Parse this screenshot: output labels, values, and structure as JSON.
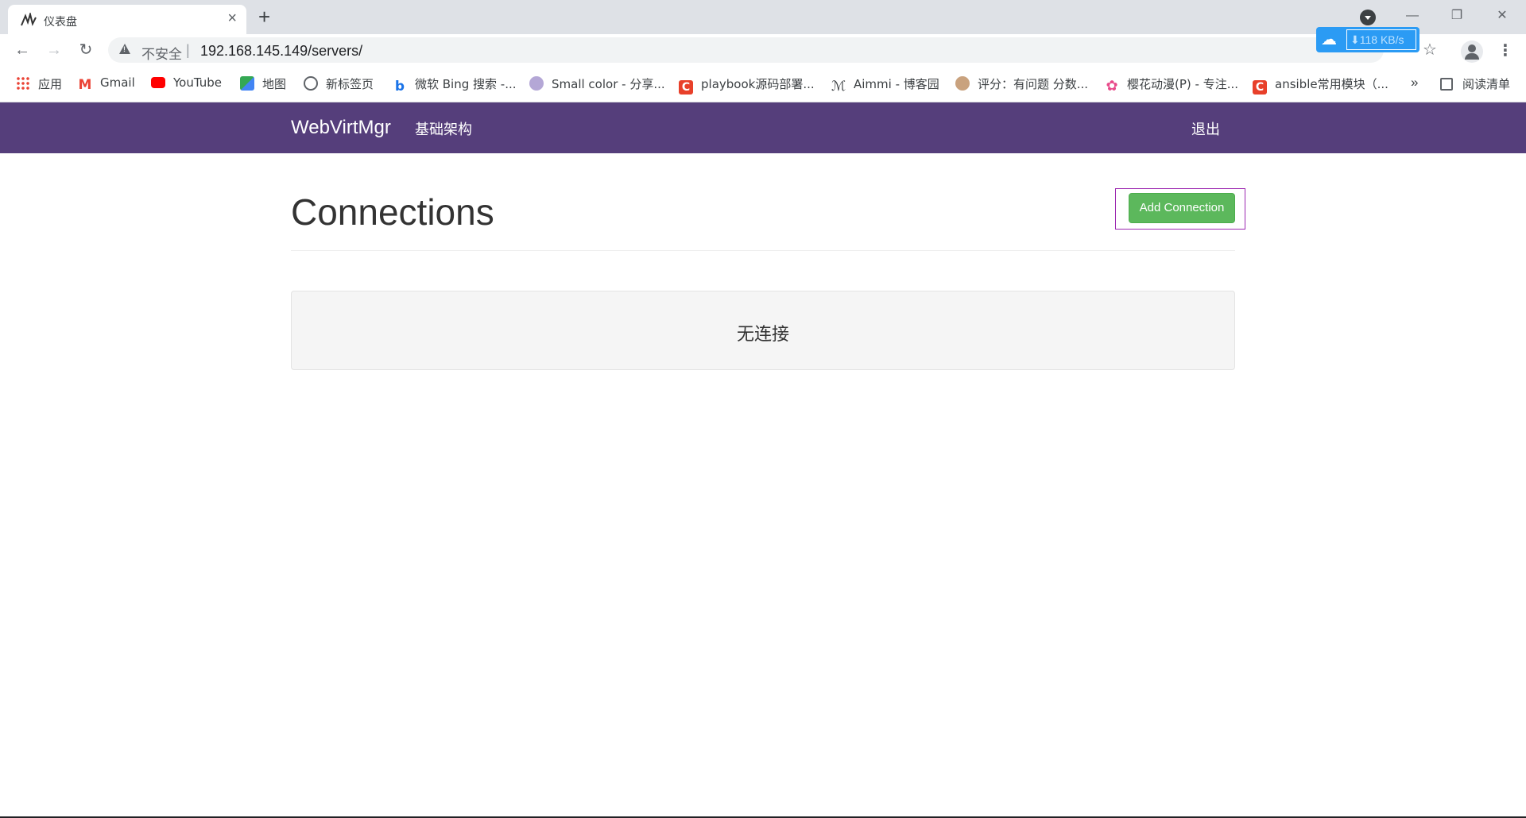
{
  "browser": {
    "tab": {
      "title": "仪表盘",
      "close": "×"
    },
    "new_tab": "+",
    "window": {
      "minimize": "—",
      "restore": "❐",
      "close": "✕"
    },
    "address": {
      "security": "不安全",
      "separator": "|",
      "url": "192.168.145.149/servers/"
    },
    "download_badge": {
      "speed": "⬇118 KB/s"
    },
    "bookmarks": [
      {
        "label": "应用",
        "icon": "apps-grid-icon",
        "color": "#ea4335"
      },
      {
        "label": "Gmail",
        "icon": "gmail-icon",
        "color": "#ea4335"
      },
      {
        "label": "YouTube",
        "icon": "youtube-icon",
        "color": "#ff0000"
      },
      {
        "label": "地图",
        "icon": "maps-icon",
        "color": "#34a853"
      },
      {
        "label": "新标签页",
        "icon": "globe-icon",
        "color": "#5f6368"
      },
      {
        "label": "微软 Bing 搜索 -...",
        "icon": "bing-icon",
        "color": "#1a73e8"
      },
      {
        "label": "Small color - 分享...",
        "icon": "smallcolor-icon",
        "color": "#8e7cc3"
      },
      {
        "label": "playbook源码部署...",
        "icon": "csdn-icon",
        "color": "#e8402a"
      },
      {
        "label": "Aimmi - 博客园",
        "icon": "aimmi-icon",
        "color": "#3c4043"
      },
      {
        "label": "评分：有问题 分数...",
        "icon": "anime-avatar-icon",
        "color": "#c9a27e"
      },
      {
        "label": "樱花动漫(P) - 专注...",
        "icon": "sakura-icon",
        "color": "#e84a8a"
      },
      {
        "label": "ansible常用模块（...",
        "icon": "csdn-icon",
        "color": "#e8402a"
      }
    ],
    "bookmarks_more": "»",
    "reading_list": "阅读清单"
  },
  "navbar": {
    "brand": "WebVirtMgr",
    "link": "基础架构",
    "logout": "退出",
    "color": "#553e7b"
  },
  "main": {
    "title": "Connections",
    "add_button": "Add Connection",
    "empty_message": "无连接"
  }
}
